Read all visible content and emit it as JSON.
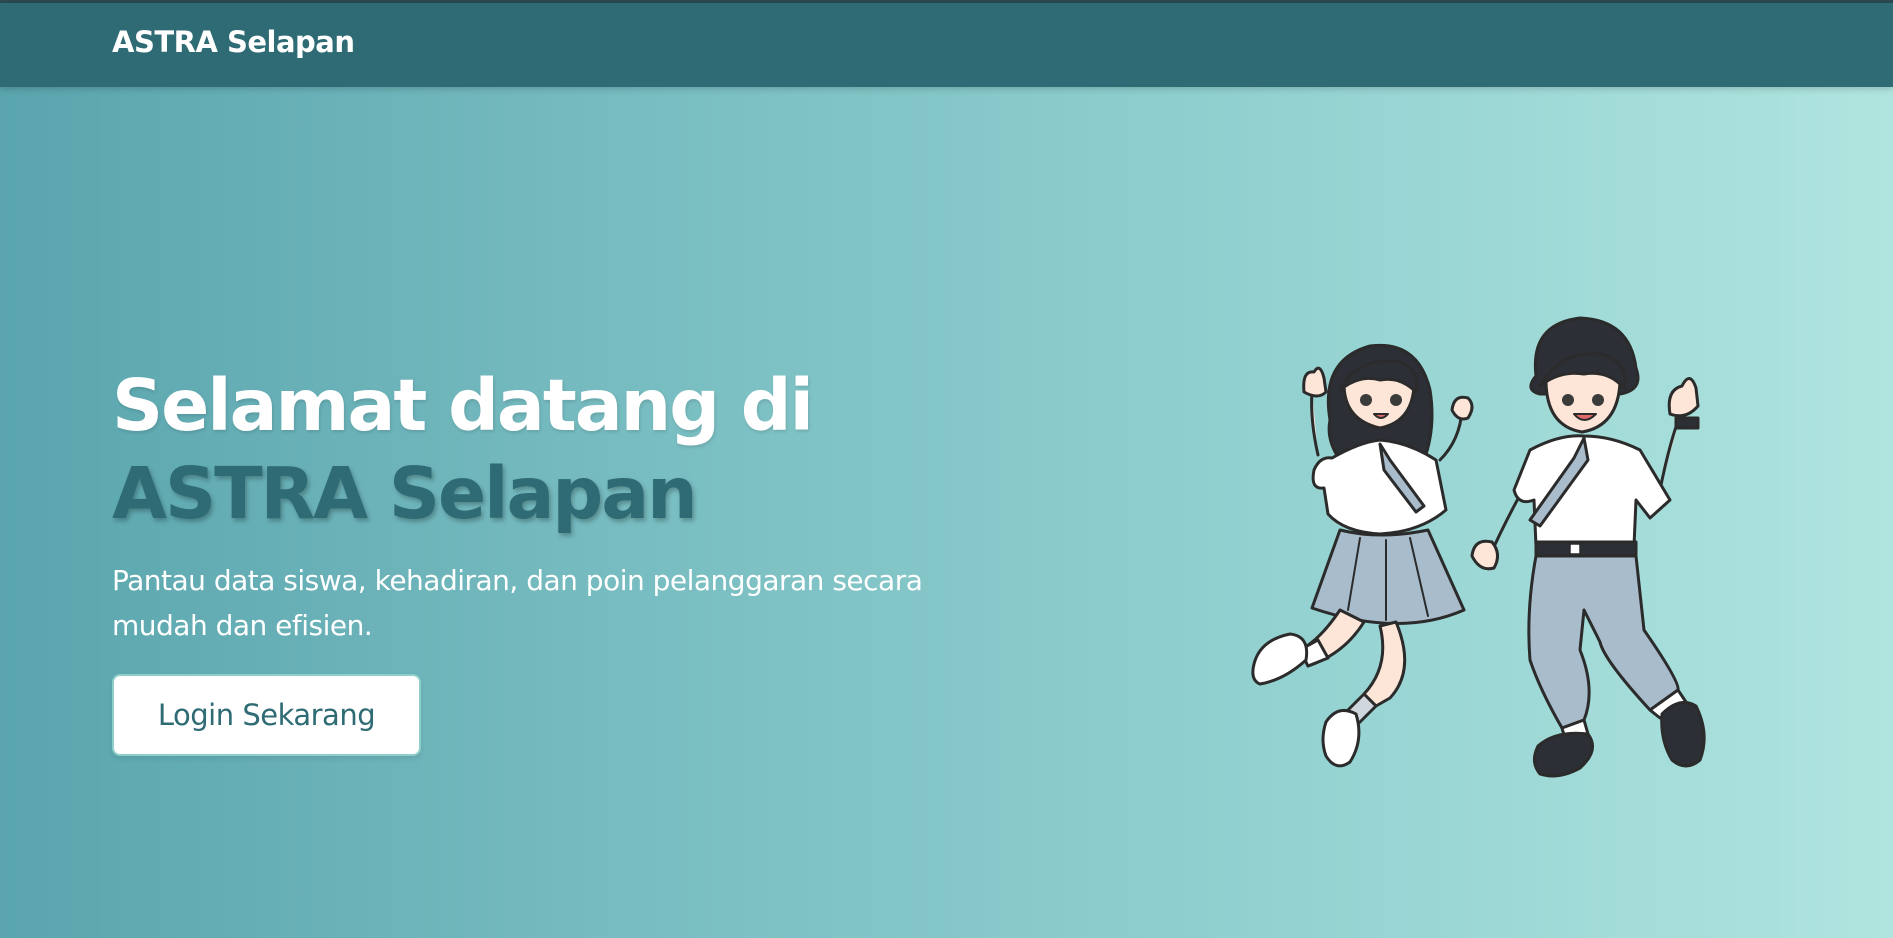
{
  "navbar": {
    "brand": "ASTRA Selapan"
  },
  "hero": {
    "title_line1": "Selamat datang di",
    "title_line2": "ASTRA Selapan",
    "subtitle": "Pantau data siswa, kehadiran, dan poin pelanggaran secara mudah dan efisien.",
    "cta_label": "Login Sekarang"
  },
  "illustration": {
    "subject": "two-students-jumping-illustration"
  },
  "colors": {
    "navbar": "#2e6b74",
    "accent_text": "#2f6b74",
    "gradient_start": "#5aa5ae",
    "gradient_end": "#b0e4df",
    "button_bg": "#ffffff"
  }
}
